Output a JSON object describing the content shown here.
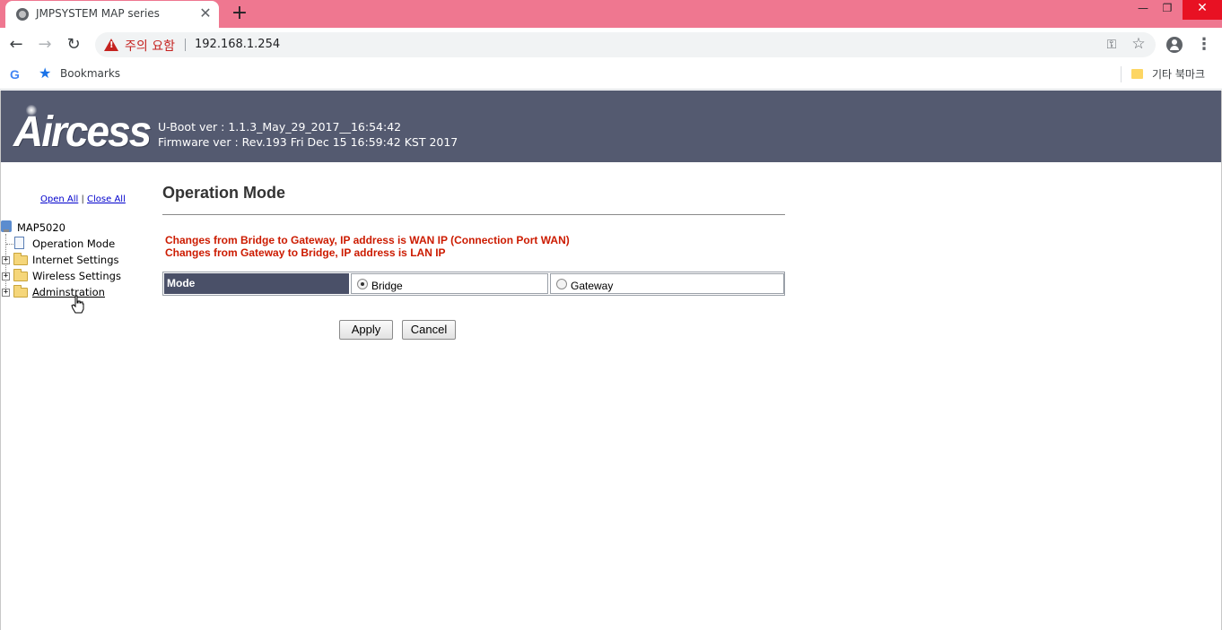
{
  "browser": {
    "tab_title": "JMPSYSTEM MAP series",
    "tab_close": "✕",
    "new_tab": "+",
    "window_controls": {
      "minimize": "—",
      "maximize": "❐",
      "close": "✕"
    },
    "nav": {
      "back": "←",
      "forward": "→",
      "reload": "↻"
    },
    "security_label": "주의 요함",
    "url": "192.168.1.254",
    "key_glyph": "⚿",
    "star_glyph": "☆",
    "menu_glyph": "⋮",
    "bookmarks": {
      "google_glyph": "G",
      "star_glyph": "★",
      "label": "Bookmarks",
      "other_folder": "기타 북마크"
    }
  },
  "header": {
    "logo": "Aircess",
    "uboot": "U-Boot ver : 1.1.3_May_29_2017__16:54:42",
    "firmware": "Firmware ver : Rev.193 Fri Dec 15 16:59:42 KST 2017"
  },
  "tree": {
    "open_all": "Open All",
    "separator": "|",
    "close_all": "Close All",
    "root": "MAP5020",
    "items": [
      {
        "label": "Operation Mode",
        "type": "page"
      },
      {
        "label": "Internet Settings",
        "type": "folder",
        "expander": "+"
      },
      {
        "label": "Wireless Settings",
        "type": "folder",
        "expander": "+"
      },
      {
        "label": "Adminstration",
        "type": "folder",
        "expander": "+"
      }
    ]
  },
  "main": {
    "title": "Operation Mode",
    "notices": [
      "Changes from Bridge to Gateway, IP address is WAN IP (Connection Port WAN)",
      "Changes from Gateway to Bridge, IP address is LAN IP"
    ],
    "mode_label": "Mode",
    "options": [
      {
        "label": "Bridge",
        "checked": true
      },
      {
        "label": "Gateway",
        "checked": false
      }
    ],
    "apply_label": "Apply",
    "cancel_label": "Cancel"
  },
  "colors": {
    "tabstrip": "#ef7790",
    "header_banner": "#545a70",
    "mode_label_bg": "#4a5068",
    "notice_text": "#cc1b00",
    "link": "#0000cc"
  }
}
